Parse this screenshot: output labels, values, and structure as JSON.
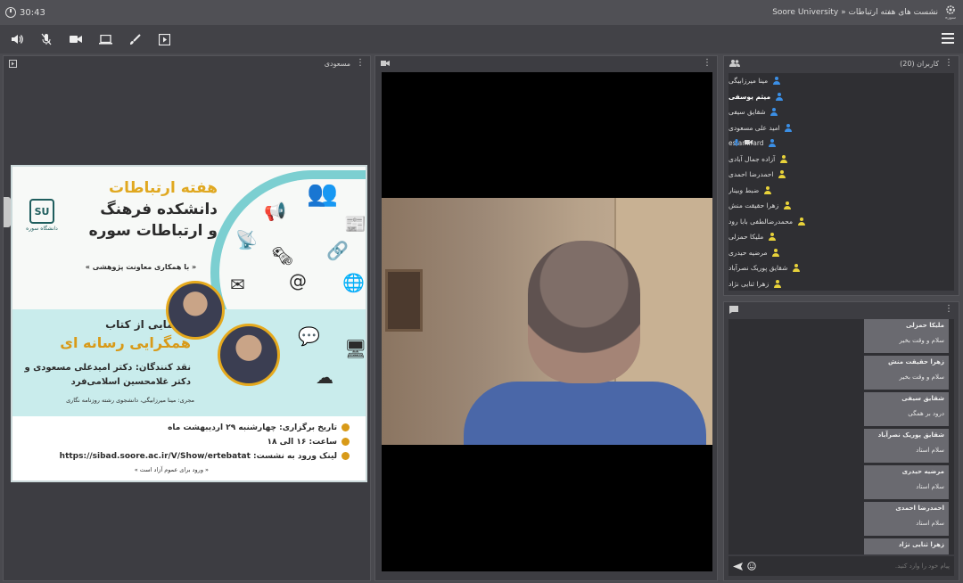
{
  "topbar": {
    "time": "30:43",
    "breadcrumb": "Soore University » نشست های هفته ارتباطات",
    "logo_caption": "سوره"
  },
  "toolbar": {
    "icons": [
      "speaker-icon",
      "mic-muted-icon",
      "camera-icon",
      "screen-share-icon",
      "brush-icon",
      "present-icon"
    ]
  },
  "presentation": {
    "header_title": "مسعودی",
    "poster": {
      "title_line1": "هفته ارتباطات",
      "title_line2": "دانشکده فرهنگ",
      "title_line3": "و ارتباطات سوره",
      "subtitle": "« با همکاری معاونت پژوهشی »",
      "logo_mark": "SU",
      "logo_text": "دانشگاه سوره",
      "band_title": "رونمایی از کتاب",
      "book_title": "همگرایی رسانه ای",
      "critics": "نقد کنندگان: دکتر امیدعلی مسعودی و دکتر غلامحسین اسلامی‌فرد",
      "host": "مجری: مینا میرزابیگی، دانشجوی رشته روزنامه نگاری",
      "date": "تاریخ برگزاری: چهارشنبه ۲۹ اردیبهشت ماه",
      "time": "ساعت: ۱۶ الی ۱۸",
      "link": "لینک ورود به نشست: https://sibad.soore.ac.ir/V/Show/ertebatat",
      "note": "« ورود برای عموم آزاد است »"
    }
  },
  "users": {
    "header": "کاربران (20)",
    "list": [
      {
        "name": "مینا میرزابیگی",
        "color": "#3b8fe6",
        "bold": false
      },
      {
        "name": "میثم یوسفی",
        "color": "#3b8fe6",
        "bold": true
      },
      {
        "name": "شقایق سیفی",
        "color": "#3b8fe6",
        "bold": false
      },
      {
        "name": "امید علی مسعودی",
        "color": "#3b8fe6",
        "bold": false
      },
      {
        "name": "eslamifard",
        "color": "#3b8fe6",
        "bold": false
      },
      {
        "name": "آزاده جمال آبادی",
        "color": "#e8d23a",
        "bold": false
      },
      {
        "name": "احمدرضا احمدی",
        "color": "#e8d23a",
        "bold": false
      },
      {
        "name": "ضبط وبینار",
        "color": "#e8d23a",
        "bold": false
      },
      {
        "name": "زهرا حقیقت منش",
        "color": "#e8d23a",
        "bold": false
      },
      {
        "name": "محمدرضالطفی بابا رود",
        "color": "#e8d23a",
        "bold": false
      },
      {
        "name": "ملیکا حمزلی",
        "color": "#e8d23a",
        "bold": false
      },
      {
        "name": "مرضیه حیدری",
        "color": "#e8d23a",
        "bold": false
      },
      {
        "name": "شقایق پوریک نصرآباد",
        "color": "#e8d23a",
        "bold": false
      },
      {
        "name": "زهرا ثنایی نژاد",
        "color": "#e8d23a",
        "bold": false
      }
    ]
  },
  "chat": {
    "messages": [
      {
        "from": "ملیکا حمزلی",
        "text": "سلام و وقت بخیر"
      },
      {
        "from": "زهرا حقیقت منش",
        "text": "سلام و وقت بخیر"
      },
      {
        "from": "شقایق سیفی",
        "text": "درود بر همگی"
      },
      {
        "from": "شقایق پوریک نصرآباد",
        "text": "سلام استاد"
      },
      {
        "from": "مرضیه حیدری",
        "text": "سلام استاد"
      },
      {
        "from": "احمدرضا احمدی",
        "text": "سلام استاد"
      },
      {
        "from": "زهرا ثنایی نژاد",
        "text": ""
      }
    ],
    "input_placeholder": "پیام خود را وارد کنید."
  }
}
